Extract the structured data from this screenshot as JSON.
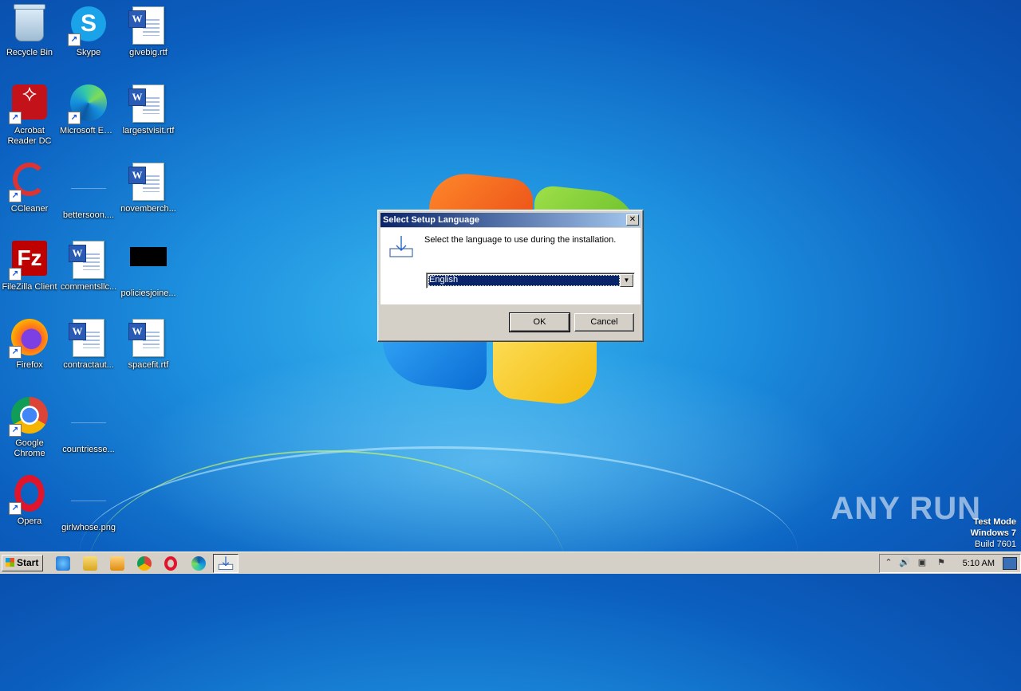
{
  "desktop": {
    "icons": [
      {
        "label": "Recycle Bin"
      },
      {
        "label": "Skype"
      },
      {
        "label": "givebig.rtf"
      },
      {
        "label": "Acrobat Reader DC"
      },
      {
        "label": "Microsoft Edge"
      },
      {
        "label": "largestvisit.rtf"
      },
      {
        "label": "CCleaner"
      },
      {
        "label": "bettersoon...."
      },
      {
        "label": "novemberch..."
      },
      {
        "label": "FileZilla Client"
      },
      {
        "label": "commentsllc..."
      },
      {
        "label": "policiesjoine..."
      },
      {
        "label": "Firefox"
      },
      {
        "label": "contractaut..."
      },
      {
        "label": "spacefit.rtf"
      },
      {
        "label": "Google Chrome"
      },
      {
        "label": "countriesse..."
      },
      {
        "label": "Opera"
      },
      {
        "label": "girlwhose.png"
      }
    ]
  },
  "dialog": {
    "title": "Select Setup Language",
    "close_glyph": "✕",
    "prompt": "Select the language to use during the installation.",
    "language_selected": "English",
    "ok_label": "OK",
    "cancel_label": "Cancel"
  },
  "taskbar": {
    "start_label": "Start",
    "clock": "5:10 AM"
  },
  "watermark": {
    "brand": "ANY RUN",
    "test_mode_line1": "Test Mode",
    "test_mode_line2": "Windows 7",
    "test_mode_line3": "Build 7601"
  }
}
